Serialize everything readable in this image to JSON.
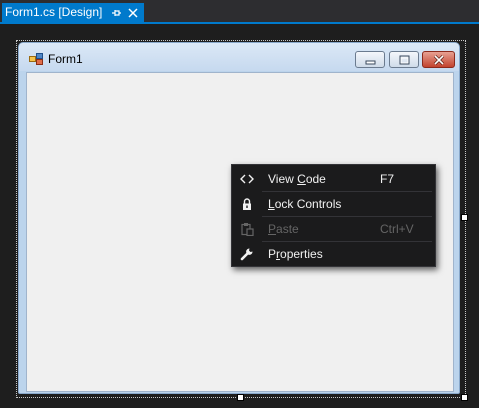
{
  "tab": {
    "title": "Form1.cs [Design]",
    "pin_icon": "pin-icon",
    "close_icon": "close-icon",
    "accent": "#007acc"
  },
  "form": {
    "title": "Form1",
    "icon": "form-icon",
    "buttons": [
      "minimize",
      "maximize",
      "close"
    ]
  },
  "context_menu": {
    "items": [
      {
        "pre": "View ",
        "mnemonic": "C",
        "post": "ode",
        "shortcut": "F7",
        "icon": "code-brackets-icon",
        "enabled": true
      },
      {
        "pre": "",
        "mnemonic": "L",
        "post": "ock Controls",
        "shortcut": "",
        "icon": "lock-icon",
        "enabled": true
      },
      {
        "pre": "",
        "mnemonic": "P",
        "post": "aste",
        "shortcut": "Ctrl+V",
        "icon": "paste-icon",
        "enabled": false
      },
      {
        "pre": "P",
        "mnemonic": "r",
        "post": "operties",
        "shortcut": "",
        "icon": "wrench-icon",
        "enabled": true
      }
    ]
  },
  "colors": {
    "menu_background": "#1b1b1c",
    "menu_text": "#f1f1f1",
    "menu_disabled_text": "#656565",
    "designer_background": "#1e1e1e",
    "form_client": "#f0f0f0"
  }
}
